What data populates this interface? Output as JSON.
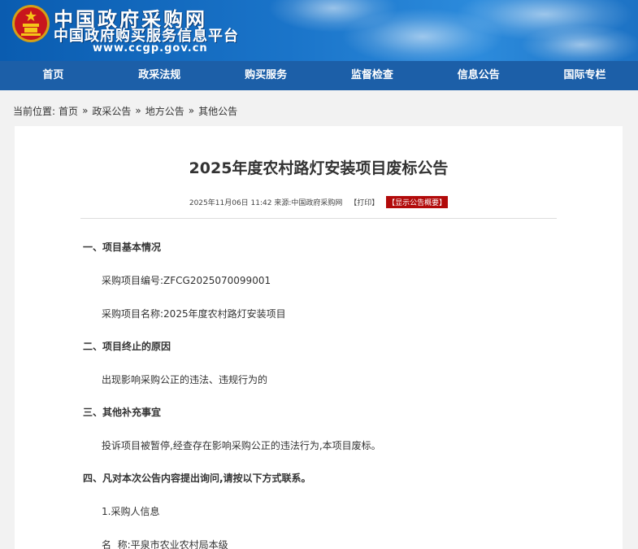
{
  "header": {
    "logo_title": "中国政府采购网",
    "logo_subtitle": "中国政府购买服务信息平台",
    "logo_url": "www.ccgp.gov.cn"
  },
  "nav": {
    "items": [
      {
        "label": "首页"
      },
      {
        "label": "政采法规"
      },
      {
        "label": "购买服务"
      },
      {
        "label": "监督检查"
      },
      {
        "label": "信息公告"
      },
      {
        "label": "国际专栏"
      }
    ]
  },
  "breadcrumb": {
    "prefix": "当前位置:",
    "items": [
      "首页",
      "政采公告",
      "地方公告",
      "其他公告"
    ],
    "separator": "»"
  },
  "article": {
    "title": "2025年度农村路灯安装项目废标公告",
    "meta": "2025年11月06日 11:42 来源:中国政府采购网",
    "print_label": "【打印】",
    "summary_label": "【显示公告概要】",
    "sections": [
      "一、项目基本情况",
      "采购项目编号:ZFCG2025070099001",
      "采购项目名称:2025年度农村路灯安装项目",
      "二、项目终止的原因",
      "出现影响采购公正的违法、违规行为的",
      "三、其他补充事宜",
      "投诉项目被暂停,经查存在影响采购公正的违法行为,本项目废标。",
      "四、凡对本次公告内容提出询问,请按以下方式联系。",
      "1.采购人信息",
      "名  称:平泉市农业农村局本级"
    ]
  },
  "colors": {
    "nav_bg": "#1c5fa8",
    "header_bg": "#1a74c9",
    "summary_bg": "#b20a0a"
  }
}
